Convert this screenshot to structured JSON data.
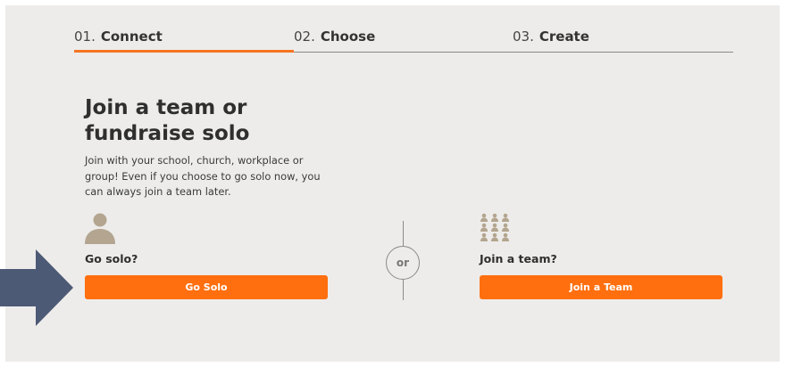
{
  "steps": [
    {
      "num": "01.",
      "name": "Connect",
      "active": true
    },
    {
      "num": "02.",
      "name": "Choose",
      "active": false
    },
    {
      "num": "03.",
      "name": "Create",
      "active": false
    }
  ],
  "heading": "Join a team or fundraise solo",
  "intro": "Join with your school, church, workplace or group! Even if you choose to go solo now, you can always join a team later.",
  "solo": {
    "label": "Go solo?",
    "button": "Go Solo",
    "icon": "person-icon"
  },
  "divider": {
    "text": "or"
  },
  "team": {
    "label": "Join a team?",
    "button": "Join a Team",
    "icon": "team-icon"
  },
  "colors": {
    "accent": "#ff6f0f",
    "icon": "#b3a58f",
    "arrow": "#4d5a75",
    "background": "#edecea"
  }
}
